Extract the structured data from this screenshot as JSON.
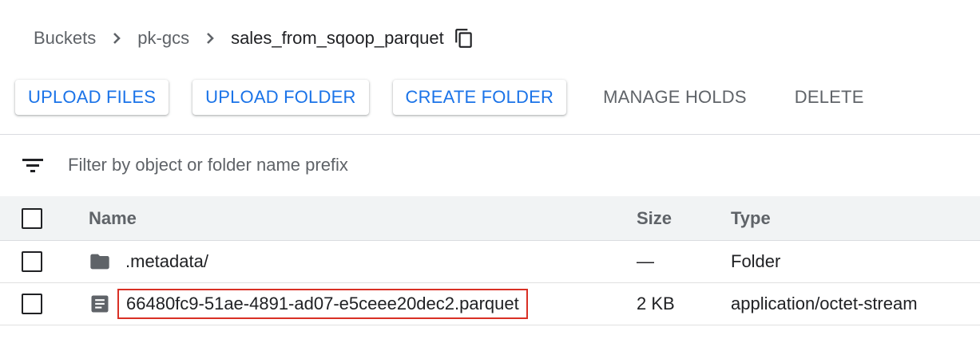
{
  "breadcrumb": {
    "items": [
      "Buckets",
      "pk-gcs"
    ],
    "current": "sales_from_sqoop_parquet",
    "copy_icon": "copy-icon"
  },
  "toolbar": {
    "upload_files": "UPLOAD FILES",
    "upload_folder": "UPLOAD FOLDER",
    "create_folder": "CREATE FOLDER",
    "manage_holds": "MANAGE HOLDS",
    "delete": "DELETE"
  },
  "filter": {
    "placeholder": "Filter by object or folder name prefix",
    "value": ""
  },
  "table": {
    "headers": {
      "name": "Name",
      "size": "Size",
      "type": "Type"
    },
    "rows": [
      {
        "icon": "folder-icon",
        "name": ".metadata/",
        "size": "—",
        "type": "Folder"
      },
      {
        "icon": "file-icon",
        "name": "66480fc9-51ae-4891-ad07-e5ceee20dec2.parquet",
        "size": "2 KB",
        "type": "application/octet-stream",
        "highlighted": true
      }
    ]
  },
  "colors": {
    "accent": "#1a73e8",
    "highlight": "#d93025",
    "header_bg": "#f1f3f4"
  }
}
